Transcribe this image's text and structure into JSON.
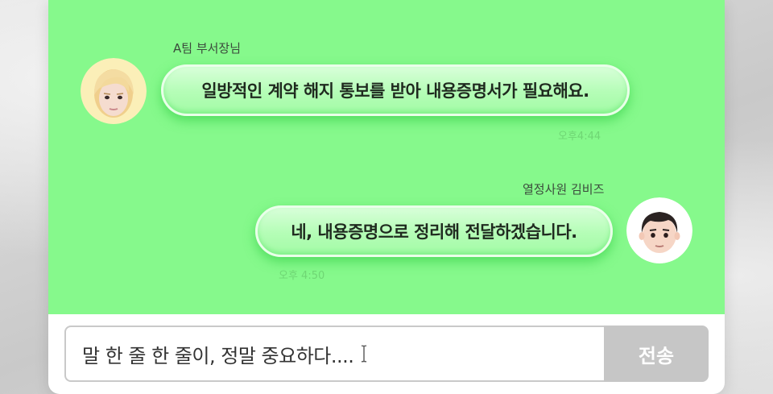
{
  "messages": [
    {
      "sender": "A팀 부서장님",
      "text": "일방적인 계약 해지 통보를 받아 내용증명서가 필요해요.",
      "time": "오후4:44"
    },
    {
      "sender": "열정사원 김비즈",
      "text": "네, 내용증명으로 정리해 전달하겠습니다.",
      "time": "오후 4:50"
    }
  ],
  "composer": {
    "value": "말 한 줄 한 줄이, 정말 중요하다....",
    "send_label": "전송"
  },
  "colors": {
    "chat_background": "#86f98c",
    "bubble": "#b4fdb6",
    "send_button": "#c6c6c6"
  }
}
